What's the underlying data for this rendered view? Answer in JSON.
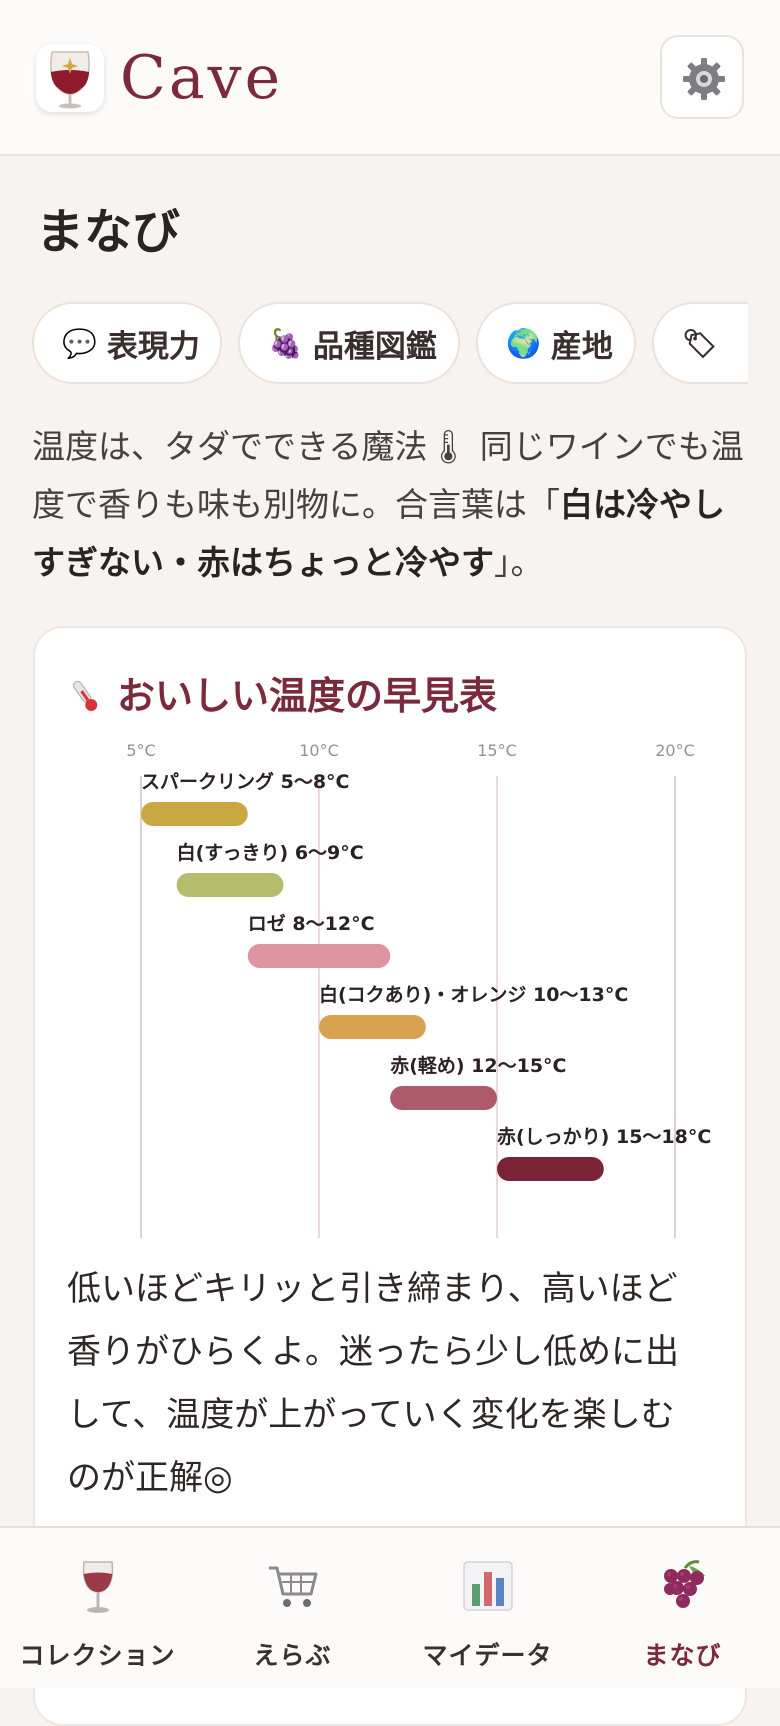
{
  "app": {
    "title": "Cave"
  },
  "page": {
    "title": "まなび"
  },
  "chips": [
    {
      "icon": "speech-bubble-icon",
      "glyph": "💬",
      "label": "表現力"
    },
    {
      "icon": "grapes-icon",
      "glyph": "🍇",
      "label": "品種図鑑"
    },
    {
      "icon": "globe-icon",
      "glyph": "🌍",
      "label": "産地"
    },
    {
      "icon": "tag-icon",
      "glyph": "🏷",
      "label": ""
    }
  ],
  "intro": {
    "part1": "温度は、タダでできる魔法🌡 同じワインでも温度で香りも味も別物に。合言葉は「",
    "emphasis": "白は冷やしすぎない・赤はちょっと冷やす",
    "part2": "」。"
  },
  "card": {
    "title": "おいしい温度の早見表",
    "body": "低いほどキリッと引き締まり、高いほど香りがひらくよ。迷ったら少し低めに出して、温度が上がっていく変化を楽しむのが正解◎"
  },
  "chart_data": {
    "type": "bar",
    "orientation": "horizontal-range",
    "x_ticks": [
      "5°C",
      "10°C",
      "15°C",
      "20°C"
    ],
    "xlim": [
      5,
      20
    ],
    "grid": true,
    "series": [
      {
        "label": "スパークリング 5〜8°C",
        "min": 5,
        "max": 8,
        "color": "#c9a843"
      },
      {
        "label": "白(すっきり) 6〜9°C",
        "min": 6,
        "max": 9,
        "color": "#b5bd6c"
      },
      {
        "label": "ロゼ 8〜12°C",
        "min": 8,
        "max": 12,
        "color": "#de95a0"
      },
      {
        "label": "白(コクあり)・オレンジ 10〜13°C",
        "min": 10,
        "max": 13,
        "color": "#d9a24e"
      },
      {
        "label": "赤(軽め) 12〜15°C",
        "min": 12,
        "max": 15,
        "color": "#ad5a6c"
      },
      {
        "label": "赤(しっかり) 15〜18°C",
        "min": 15,
        "max": 18,
        "color": "#7a2236"
      }
    ]
  },
  "nav": [
    {
      "icon": "wine-glass-icon",
      "label": "コレクション",
      "active": false
    },
    {
      "icon": "shopping-cart-icon",
      "label": "えらぶ",
      "active": false
    },
    {
      "icon": "bar-chart-icon",
      "label": "マイデータ",
      "active": false
    },
    {
      "icon": "grapes-icon",
      "label": "まなび",
      "active": true
    }
  ],
  "colors": {
    "accent": "#7a2a3c",
    "background": "#f7f3f0",
    "card": "#ffffff"
  }
}
